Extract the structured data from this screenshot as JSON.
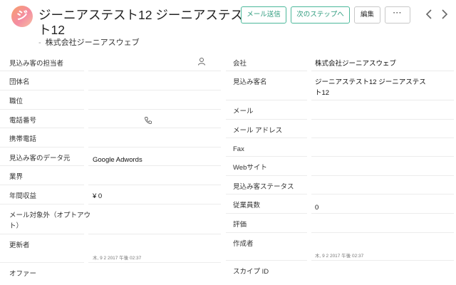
{
  "record": {
    "avatar_char": "ジ",
    "title": "ジーニアステスト12 ジーニアステスト12",
    "subtitle_dash": "-",
    "subtitle": "株式会社ジーニアスウェブ"
  },
  "actions": {
    "send_mail": "メール送信",
    "next_step": "次のステップへ",
    "edit": "編集",
    "more": "···"
  },
  "fields_left": {
    "owner": {
      "label": "見込み客の担当者",
      "value": ""
    },
    "organization": {
      "label": "団体名",
      "value": ""
    },
    "position": {
      "label": "職位",
      "value": ""
    },
    "phone": {
      "label": "電話番号",
      "value": ""
    },
    "mobile": {
      "label": "携帯電話",
      "value": ""
    },
    "lead_source": {
      "label": "見込み客のデータ元",
      "value": "Google Adwords"
    },
    "industry": {
      "label": "業界",
      "value": ""
    },
    "annual_revenue": {
      "label": "年間収益",
      "value": "¥ 0"
    },
    "email_opt_out": {
      "label": "メール対象外（オプトアウト）",
      "value": ""
    },
    "modified_by": {
      "label": "更新者",
      "value": "",
      "timestamp": "木, 9 2 2017 午後 02:37"
    },
    "offer": {
      "label": "オファー",
      "value": ""
    }
  },
  "fields_right": {
    "company": {
      "label": "会社",
      "value": "株式会社ジーニアスウェブ"
    },
    "lead_name": {
      "label": "見込み客名",
      "value": "ジーニアステスト12 ジーニアステスト12"
    },
    "email": {
      "label": "メール",
      "value": ""
    },
    "email_address": {
      "label": "メール アドレス",
      "value": ""
    },
    "fax": {
      "label": "Fax",
      "value": ""
    },
    "website": {
      "label": "Webサイト",
      "value": ""
    },
    "lead_status": {
      "label": "見込み客ステータス",
      "value": ""
    },
    "employees": {
      "label": "従業員数",
      "value": "0"
    },
    "rating": {
      "label": "評価",
      "value": ""
    },
    "created_by": {
      "label": "作成者",
      "value": "",
      "timestamp": "木, 9 2 2017 午後 02:37"
    },
    "skype_id": {
      "label": "スカイプ ID",
      "value": ""
    }
  },
  "icons": {
    "owner": "person-icon",
    "phone": "phone-icon",
    "prev": "chevron-left-icon",
    "next": "chevron-right-icon"
  },
  "colors": {
    "accent_green": "#2f9c7e",
    "avatar_gradient_start": "#f8a06a",
    "avatar_gradient_end": "#f48ca2"
  }
}
